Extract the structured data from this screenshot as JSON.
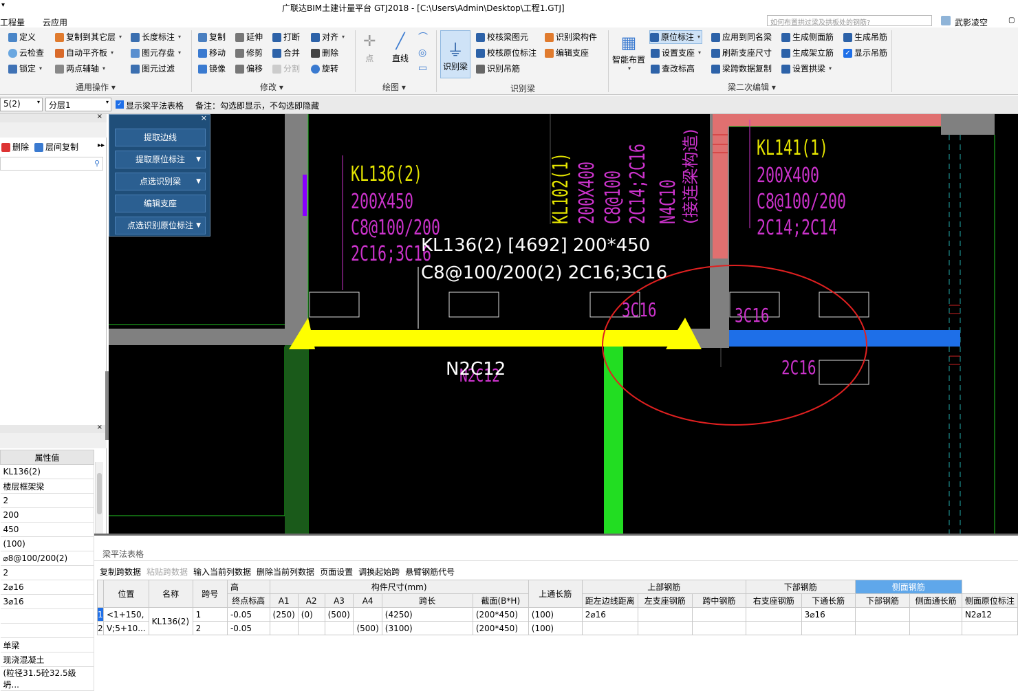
{
  "titlebar": {
    "title": "广联达BIM土建计量平台 GTJ2018 - [C:\\Users\\Admin\\Desktop\\工程1.GTJ]",
    "dropdown": "▾"
  },
  "menubar": {
    "items": [
      "工程量",
      "云应用"
    ],
    "search_placeholder": "如何布置拱过梁及拱板处的钢筋?",
    "user": "武影凌空"
  },
  "ribbon": {
    "general": {
      "items": [
        "定义",
        "复制到其它层",
        "长度标注",
        "云检查",
        "自动平齐板",
        "图元存盘",
        "锁定",
        "两点辅轴",
        "图元过滤"
      ],
      "label": "通用操作"
    },
    "modify": {
      "items": [
        "复制",
        "延伸",
        "打断",
        "对齐",
        "移动",
        "修剪",
        "合并",
        "删除",
        "镜像",
        "偏移",
        "分割",
        "旋转"
      ],
      "label": "修改"
    },
    "draw": {
      "items": [
        "点",
        "直线"
      ],
      "label": "绘图"
    },
    "identify": {
      "items": [
        "识别梁",
        "校核梁图元",
        "识别梁构件",
        "校核原位标注",
        "编辑支座",
        "识别吊筋"
      ],
      "label": "识别梁"
    },
    "beam2": {
      "items": [
        "智能布置",
        "原位标注",
        "应用到同名梁",
        "生成侧面筋",
        "生成吊筋",
        "设置支座",
        "刷新支座尺寸",
        "生成架立筋",
        "显示吊筋",
        "查改标高",
        "梁跨数据复制",
        "设置拱梁"
      ],
      "label": "梁二次编辑"
    }
  },
  "secondbar": {
    "floor": "5(2)",
    "layer": "分层1",
    "checkbox_label": "显示梁平法表格",
    "note": "备注：勾选即显示，不勾选即隐藏"
  },
  "leftpanel": {
    "delete": "删除",
    "copy": "层间复制",
    "prop_header": "属性值",
    "props": [
      "KL136(2)",
      "楼层框架梁",
      "2",
      "200",
      "450",
      "(100)",
      "⌀8@100/200(2)",
      "2",
      "2⌀16",
      "3⌀16",
      "",
      "",
      "单梁",
      "现浇混凝土",
      "(粒径31.5砼32.5级坍..."
    ]
  },
  "floatpanel": {
    "buttons": [
      "提取边线",
      "提取原位标注",
      "点选识别梁",
      "编辑支座",
      "点选识别原位标注"
    ]
  },
  "canvas": {
    "kl136": [
      "KL136(2)",
      "200X450",
      "C8@100/200",
      "2C16;3C16"
    ],
    "kl102": [
      "KL102(1)",
      "200X400",
      "C8@100",
      "2C14;2C16",
      "N4C10",
      "(接连梁构造)"
    ],
    "kl141": [
      "KL141(1)",
      "200X400",
      "C8@100/200",
      "2C14;2C14"
    ],
    "info_line1": "KL136(2) [4692] 200*450",
    "info_line2": "C8@100/200(2) 2C16;3C16",
    "label_3c16_a": "3C16",
    "label_3c16_b": "3C16",
    "label_2c16": "2C16",
    "label_n2c12": "N2C12",
    "label_n2c12_shadow": "N2C12"
  },
  "table": {
    "title": "梁平法表格",
    "toolbar": [
      "复制跨数据",
      "粘贴跨数据",
      "输入当前列数据",
      "删除当前列数据",
      "页面设置",
      "调换起始跨",
      "悬臂钢筋代号"
    ],
    "groups": {
      "dims": "构件尺寸(mm)",
      "top": "上部钢筋",
      "bottom": "下部钢筋",
      "side": "侧面钢筋",
      "elev_frag": "高"
    },
    "headers": [
      "位置",
      "名称",
      "跨号",
      "终点标高",
      "A1",
      "A2",
      "A3",
      "A4",
      "跨长",
      "截面(B*H)",
      "距左边线距离",
      "上通长筋",
      "左支座钢筋",
      "跨中钢筋",
      "右支座钢筋",
      "下通长筋",
      "下部钢筋",
      "侧面通长筋",
      "侧面原位标注"
    ],
    "rows": [
      {
        "no": "1",
        "pos": "<1+150,",
        "pos2": "V;5+10...",
        "name": "KL136(2)",
        "span": "1",
        "elev": "-0.05",
        "a1": "(250)",
        "a2": "(0)",
        "a3": "(500)",
        "a4": "",
        "len": "(4250)",
        "sec": "(200*450)",
        "dist": "(100)",
        "top_long": "2⌀16",
        "bot_long": "3⌀16",
        "side_in": "N2⌀12"
      },
      {
        "no": "2",
        "span": "2",
        "elev": "-0.05",
        "a1": "",
        "a2": "",
        "a3": "",
        "a4": "(500)",
        "len": "(3100)",
        "sec": "(200*450)",
        "dist": "(100)"
      }
    ]
  },
  "colors": {
    "canvas_bg": "#000000",
    "beam_yellow": "#ffff00",
    "beam_blue": "#1e6fe8",
    "beam_green": "#22dd22",
    "wall_red": "#e06c6c",
    "annot_magenta": "#cc33cc",
    "annot_yellow": "#e6e600",
    "circle_red": "#e02020"
  }
}
